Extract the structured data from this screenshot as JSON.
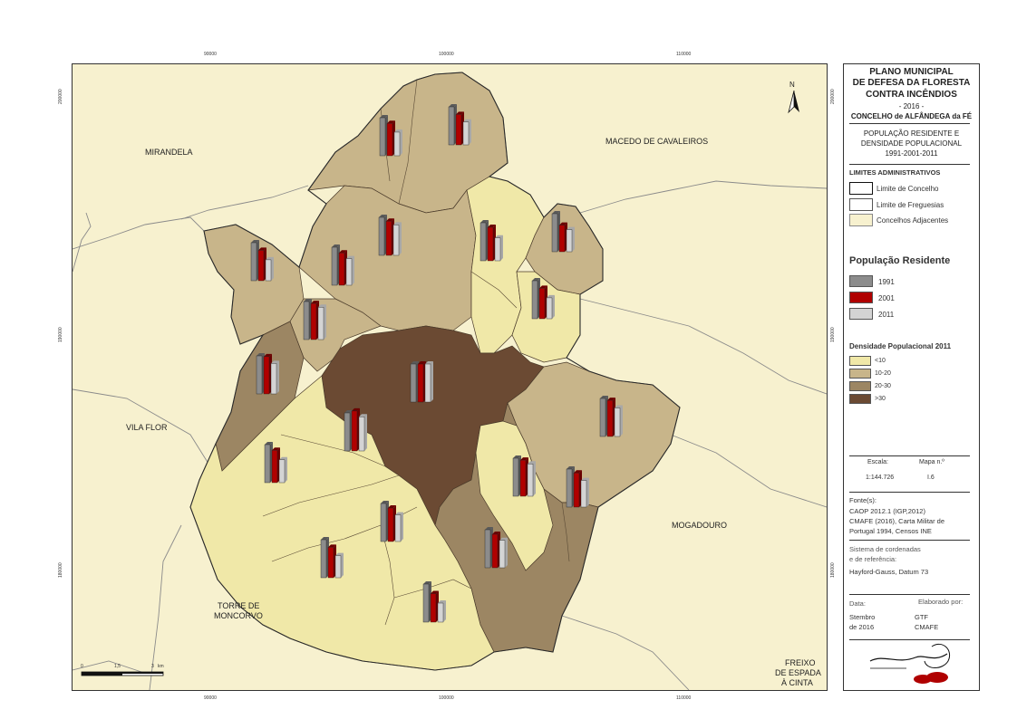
{
  "title": {
    "line1": "PLANO MUNICIPAL",
    "line2": "DE DEFESA DA FLORESTA",
    "line3": "CONTRA INCÊNDIOS",
    "year": "- 2016 -",
    "municipality": "CONCELHO de ALFÂNDEGA da FÉ"
  },
  "subtitle": {
    "line1": "POPULAÇÃO RESIDENTE E",
    "line2": "DENSIDADE POPULACIONAL",
    "line3": "1991-2001-2011"
  },
  "limits": {
    "heading": "LIMITES ADMINISTRATIVOS",
    "items": [
      "Limite de Concelho",
      "Limite de Freguesias",
      "Concelhos Adjacentes"
    ]
  },
  "population": {
    "heading": "População Residente",
    "items": [
      {
        "label": "1991",
        "color": "#8c8c8c"
      },
      {
        "label": "2001",
        "color": "#b00000"
      },
      {
        "label": "2011",
        "color": "#d4d4d4"
      }
    ]
  },
  "density": {
    "heading": "Densidade Populacional 2011",
    "classes": [
      {
        "label": "<10",
        "color": "#f0e8a8"
      },
      {
        "label": "10-20",
        "color": "#c8b58a"
      },
      {
        "label": "20-30",
        "color": "#9c8663"
      },
      {
        "label": ">30",
        "color": "#6b4a33"
      }
    ]
  },
  "scale": {
    "label": "Escala:",
    "value": "1:144.726"
  },
  "map_number": {
    "label": "Mapa n.º",
    "value": "I.6"
  },
  "sources": {
    "label": "Fonte(s):",
    "lines": [
      "CAOP 2012.1 (IGP,2012)",
      "CMAFE (2016), Carta Militar de",
      "Portugal 1994, Censos INE"
    ]
  },
  "crs": {
    "label1": "Sistema de cordenadas",
    "label2": "e de referência:",
    "value": "Hayford-Gauss, Datum 73"
  },
  "date": {
    "label": "Data:",
    "value1": "Stembro",
    "value2": "de 2016"
  },
  "author": {
    "label": "Elaborado por:",
    "value1": "GTF",
    "value2": "CMAFE"
  },
  "map": {
    "north": "N",
    "neighbors": {
      "mirandela": "MIRANDELA",
      "macedo": "MACEDO DE CAVALEIROS",
      "vila_flor": "VILA FLOR",
      "mogadouro": "MOGADOURO",
      "torre1": "TORRE DE",
      "torre2": "MONCORVO",
      "freixo1": "FREIXO",
      "freixo2": "DE ESPADA",
      "freixo3": "À CINTA"
    },
    "x_ticks": [
      "90000",
      "100000",
      "110000"
    ],
    "y_ticks": [
      "200000",
      "190000",
      "180000"
    ],
    "scalebar": [
      "0",
      "1,5",
      "3",
      "km"
    ]
  }
}
